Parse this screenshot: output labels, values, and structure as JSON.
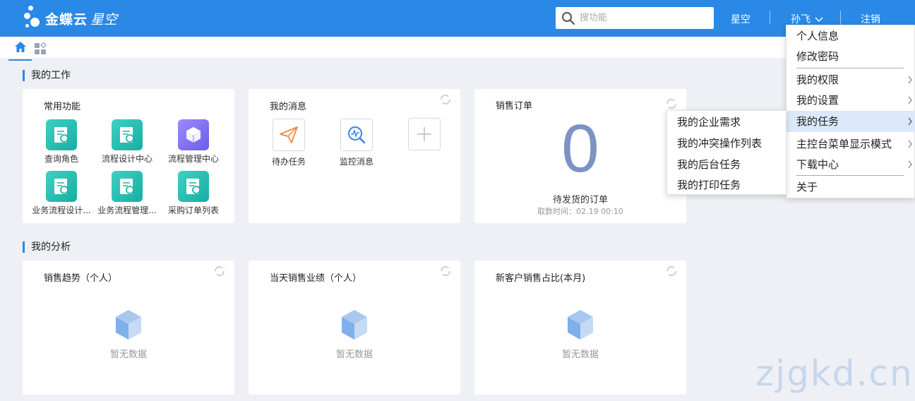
{
  "header": {
    "logo_main": "金蝶云",
    "logo_sub": "星空",
    "search_placeholder": "搜功能",
    "product_link": "星空",
    "user_name": "孙飞",
    "logout_label": "注销"
  },
  "sections": {
    "work_title": "我的工作",
    "analysis_title": "我的分析"
  },
  "common_functions": {
    "title": "常用功能",
    "items": [
      {
        "label": "查询角色",
        "icon": "report-search-icon"
      },
      {
        "label": "流程设计中心",
        "icon": "report-search-icon"
      },
      {
        "label": "流程管理中心",
        "icon": "cube-icon"
      },
      {
        "label": "业务流程设计...",
        "icon": "report-search-icon"
      },
      {
        "label": "业务流程管理...",
        "icon": "report-search-icon"
      },
      {
        "label": "采购订单列表",
        "icon": "report-search-icon"
      }
    ]
  },
  "messages": {
    "title": "我的消息",
    "items": [
      {
        "label": "待办任务",
        "icon": "paper-plane-icon"
      },
      {
        "label": "监控消息",
        "icon": "monitor-search-icon"
      }
    ]
  },
  "sales_order": {
    "title": "销售订单",
    "count": "0",
    "label": "待发货的订单",
    "fetch_time": "取数时间：02.19 00:10"
  },
  "analysis": [
    {
      "title": "销售趋势（个人）",
      "empty": "暂无数据"
    },
    {
      "title": "当天销售业绩（个人）",
      "empty": "暂无数据"
    },
    {
      "title": "新客户销售占比(本月)",
      "empty": "暂无数据"
    }
  ],
  "user_menu": {
    "items": [
      "个人信息",
      "修改密码",
      "我的权限",
      "我的设置",
      "我的任务",
      "主控台菜单显示模式",
      "下载中心",
      "关于"
    ],
    "active": "我的任务"
  },
  "task_submenu": {
    "items": [
      "我的企业需求",
      "我的冲突操作列表",
      "我的后台任务",
      "我的打印任务"
    ]
  },
  "watermark": "zjgkd.cn",
  "colors": {
    "header_blue": "#2a88e6",
    "teal_icon": "#1fb5a8",
    "purple_icon": "#7b6cf0",
    "big_number": "#7c93c3"
  }
}
